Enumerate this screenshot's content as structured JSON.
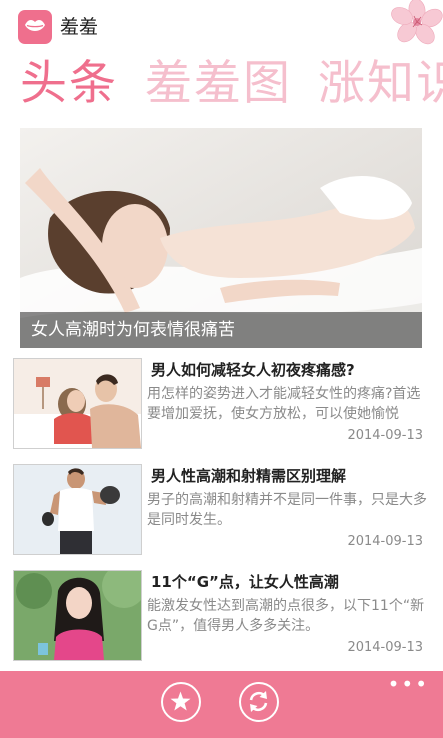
{
  "app": {
    "title": "羞羞",
    "icon": "lips-icon"
  },
  "pivot": {
    "items": [
      {
        "label": "头条",
        "active": true
      },
      {
        "label": "羞羞图",
        "active": false
      },
      {
        "label": "涨知识",
        "active": false
      }
    ]
  },
  "hero": {
    "caption": "女人高潮时为何表情很痛苦"
  },
  "articles": [
    {
      "title": "男人如何减轻女人初夜疼痛感?",
      "summary": "用怎样的姿势进入才能减轻女性的疼痛?首选要增加爱抚，使女方放松，可以使她愉悦",
      "date": "2014-09-13"
    },
    {
      "title": "男人性高潮和射精需区别理解",
      "summary": "男子的高潮和射精并不是同一件事，只是大多是同时发生。",
      "date": "2014-09-13"
    },
    {
      "title": "11个“G”点，让女人性高潮",
      "summary": "能激发女性达到高潮的点很多，以下11个“新G点”，值得男人多多关注。",
      "date": "2014-09-13"
    }
  ],
  "appbar": {
    "buttons": [
      {
        "icon": "star-icon"
      },
      {
        "icon": "refresh-icon"
      }
    ],
    "more": "•••"
  },
  "colors": {
    "accent": "#ef6f8d",
    "inactive_pivot": "#f5bfcd",
    "appbar": "#ef7a94"
  }
}
